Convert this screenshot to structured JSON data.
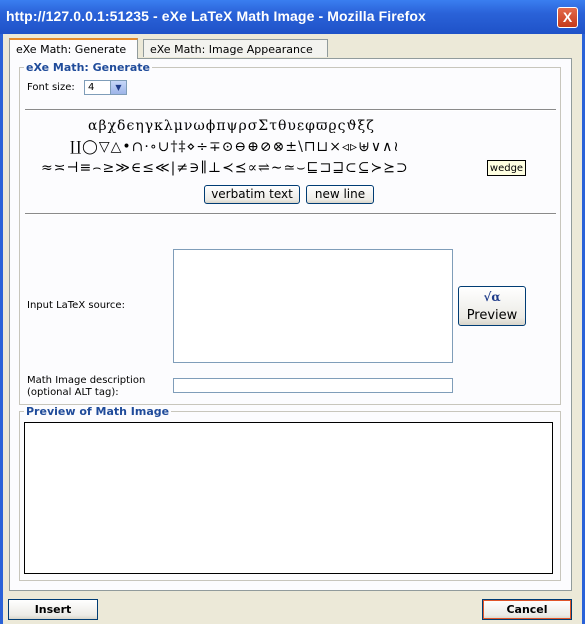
{
  "window": {
    "title": "http://127.0.0.1:51235 - eXe LaTeX Math Image - Mozilla Firefox",
    "close_glyph": "X"
  },
  "tabs": [
    {
      "label": "eXe Math: Generate",
      "active": true
    },
    {
      "label": "eXe Math: Image Appearance",
      "active": false
    }
  ],
  "generate": {
    "legend": "eXe Math: Generate",
    "font_size_label": "Font size:",
    "font_size_value": "4",
    "symbols_row1": [
      "α",
      "β",
      "χ",
      "δ",
      "ϵ",
      "η",
      "γ",
      "κ",
      "λ",
      "μ",
      "ν",
      "ω",
      "ϕ",
      "π",
      "ψ",
      "ρ",
      "σ",
      "Σ",
      "τ",
      "θ",
      "υ",
      "ε",
      "φ",
      "ϖ",
      "ϱ",
      "ς",
      "ϑ",
      "ξ",
      "ζ"
    ],
    "symbols_row2": [
      "∐",
      "◯",
      "▽",
      "△",
      "•",
      "∩",
      "·",
      "∘",
      "∪",
      "†",
      "‡",
      "⋄",
      "÷",
      "∓",
      "⊙",
      "⊖",
      "⊕",
      "⊘",
      "⊗",
      "±",
      "\\",
      "⊓",
      "⊔",
      "×",
      "◃",
      "▹",
      "⊎",
      "∨",
      "∧",
      "≀"
    ],
    "symbols_row3": [
      "≈",
      "≍",
      "⊣",
      "≡",
      "⌢",
      "≥",
      "≫",
      "∈",
      "≤",
      "≪",
      "|",
      "≠",
      "∋",
      "∥",
      "⊥",
      "≺",
      "⪯",
      "∝",
      "⇌",
      "∼",
      "≃",
      "⌣",
      "⊑",
      "⊐",
      "⊒",
      "⊂",
      "⊆",
      "≻",
      "⪰",
      "⊃"
    ],
    "tooltip": "wedge",
    "verbatim_button": "verbatim text",
    "newline_button": "new line",
    "input_label": "Input LaTeX source:",
    "preview_button_icon": "√α",
    "preview_button_label": "Preview",
    "description_label_line1": "Math Image description",
    "description_label_line2": "(optional ALT tag):",
    "latex_source_value": "",
    "description_value": ""
  },
  "preview": {
    "legend": "Preview of Math Image"
  },
  "footer": {
    "insert_label": "Insert",
    "cancel_label": "Cancel"
  },
  "colors": {
    "titlebar": "#2a62d8",
    "legend_text": "#1f4b9a",
    "active_tab_accent": "#e68b2c",
    "dialog_bg": "#ece9d8"
  }
}
